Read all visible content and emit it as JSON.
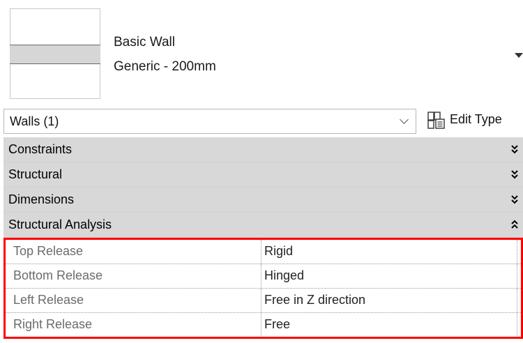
{
  "type_selector": {
    "family": "Basic Wall",
    "type": "Generic - 200mm"
  },
  "filter": {
    "selected": "Walls (1)",
    "edit_type_label": "Edit Type"
  },
  "groups": [
    {
      "label": "Constraints",
      "expanded": false
    },
    {
      "label": "Structural",
      "expanded": false
    },
    {
      "label": "Dimensions",
      "expanded": false
    },
    {
      "label": "Structural Analysis",
      "expanded": true
    }
  ],
  "parameters": [
    {
      "name": "Top Release",
      "value": "Rigid"
    },
    {
      "name": "Bottom Release",
      "value": "Hinged"
    },
    {
      "name": "Left Release",
      "value": "Free in Z direction"
    },
    {
      "name": "Right Release",
      "value": "Free"
    }
  ],
  "colors": {
    "highlight_border": "#ff0000",
    "group_header_bg": "#d8d8d8",
    "param_name_text": "#6b6b6b"
  },
  "icons": {
    "type_dropdown": "dropdown-arrow-icon",
    "filter_dropdown": "chevron-down-icon",
    "edit_type": "edit-type-icon",
    "group_collapsed": "double-chevron-down-icon",
    "group_expanded": "double-chevron-up-icon"
  }
}
